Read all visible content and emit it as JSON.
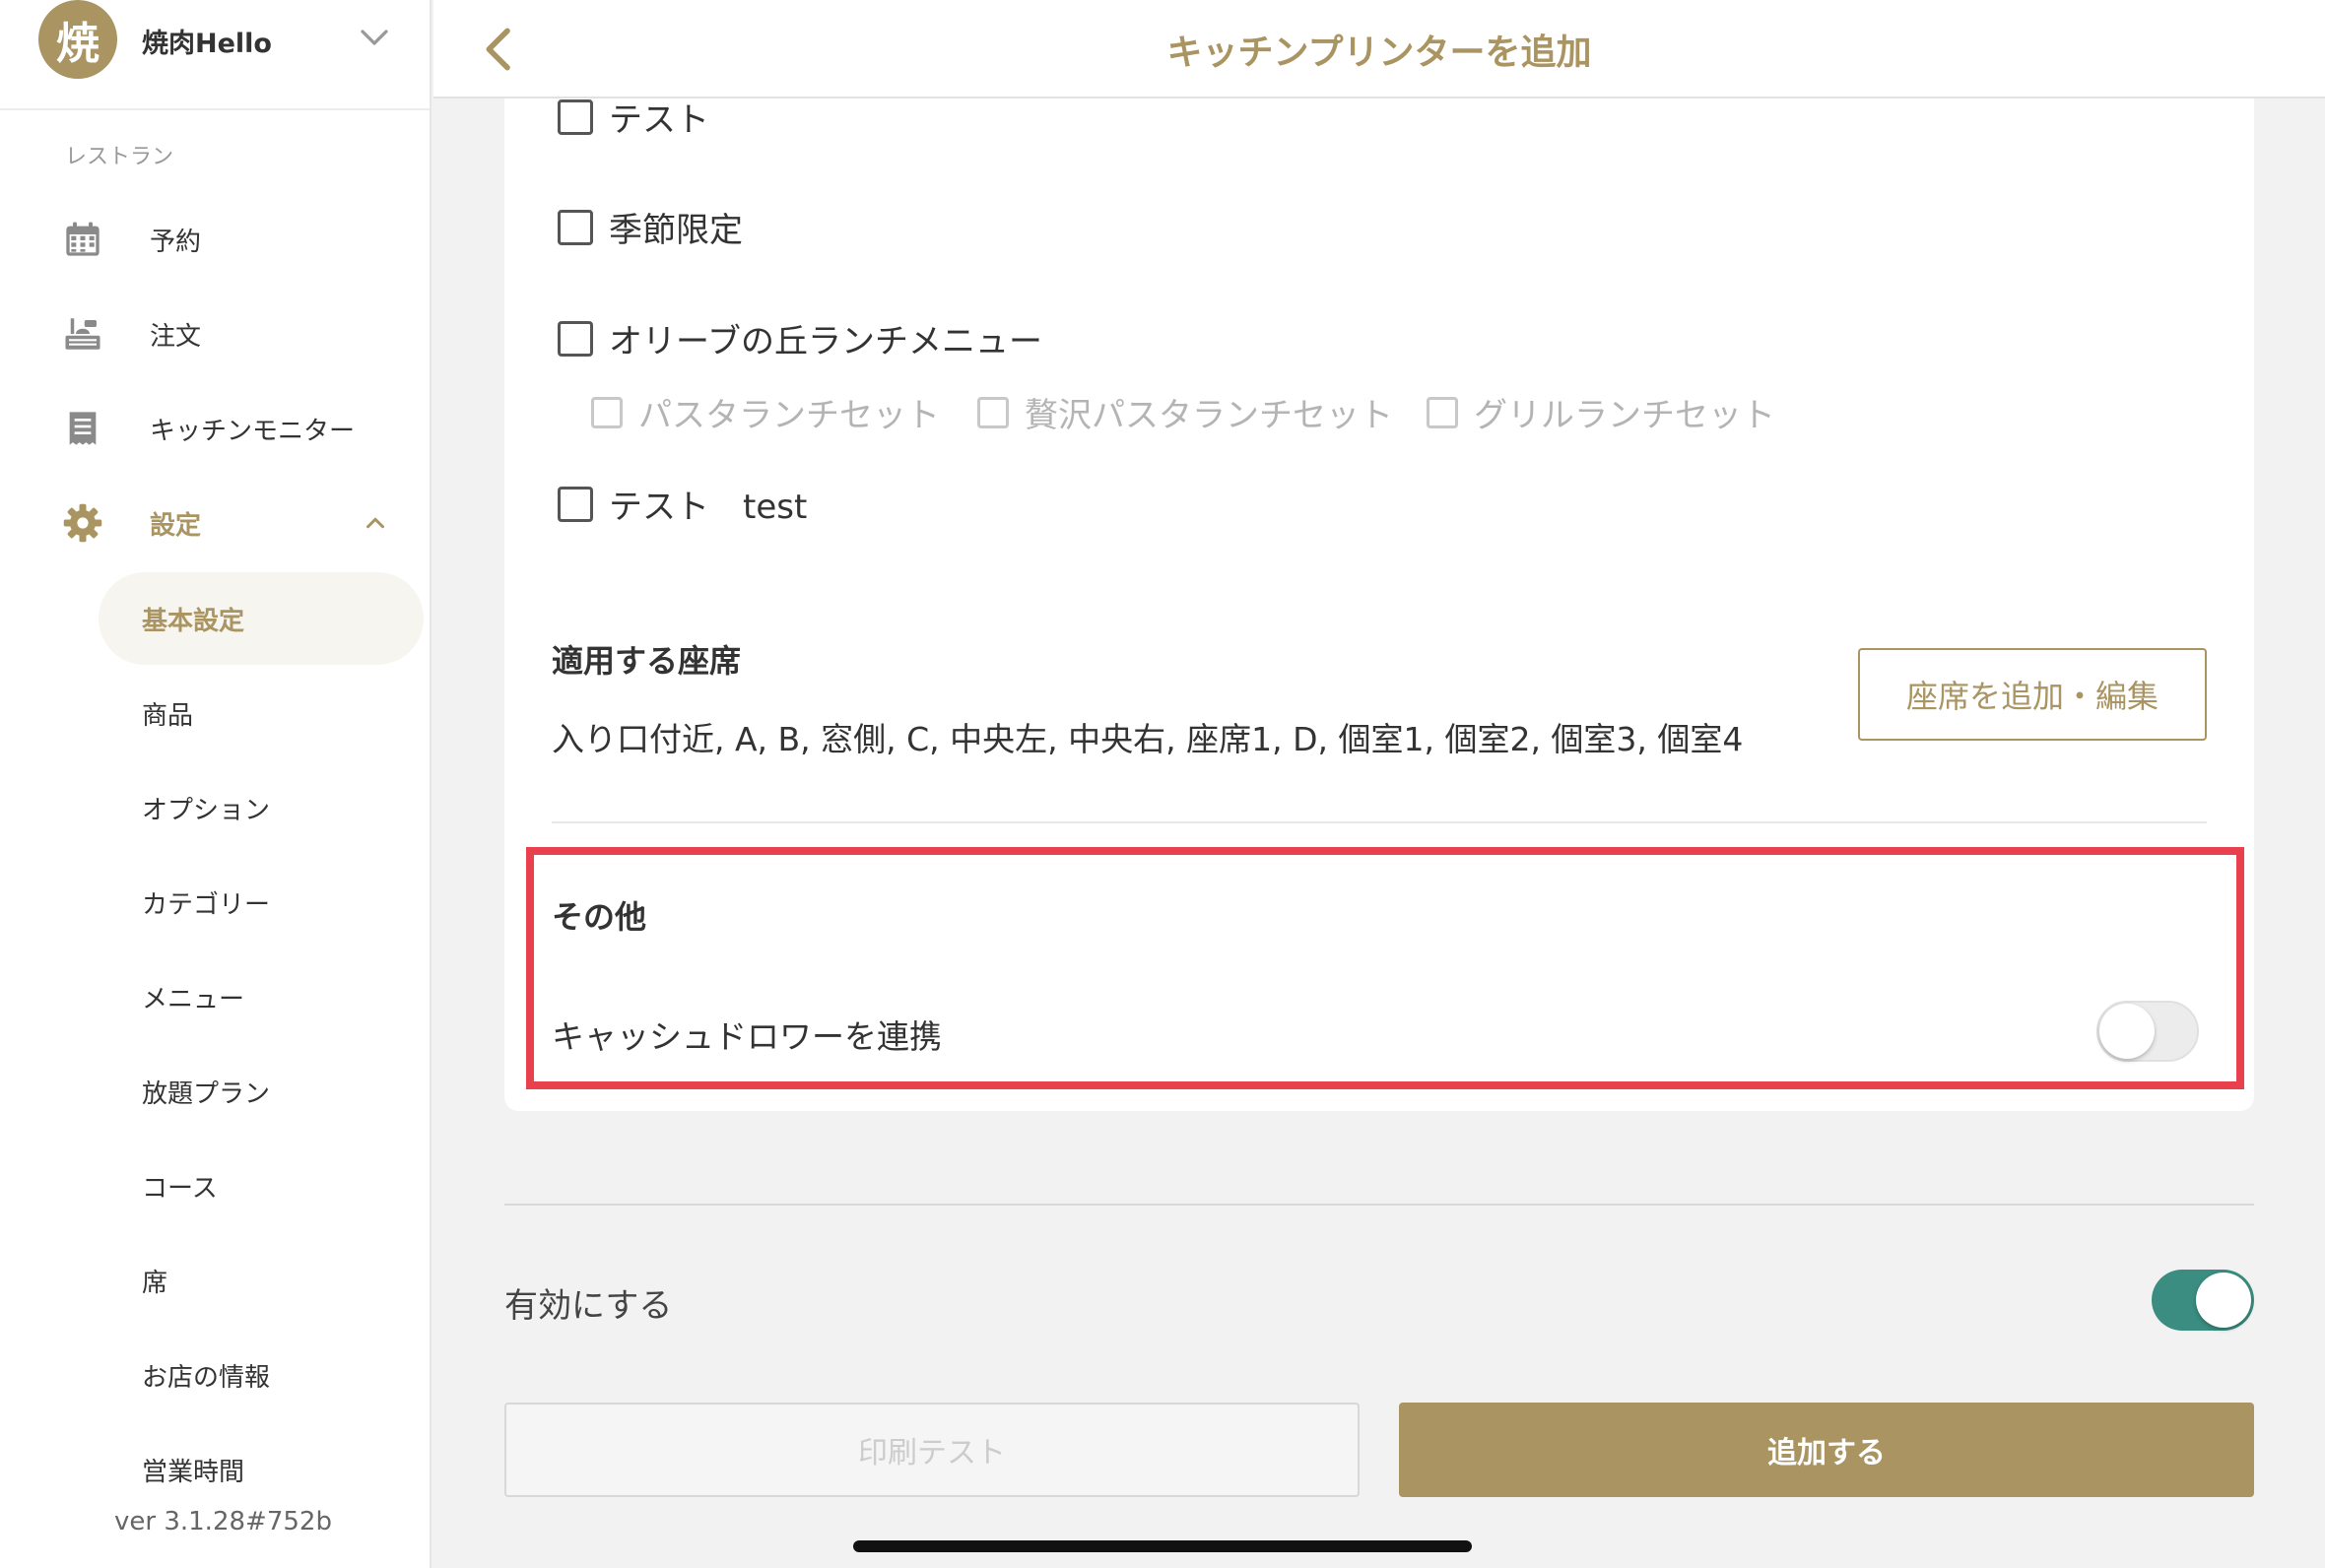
{
  "store": {
    "avatar_char": "焼",
    "name": "焼肉Hello"
  },
  "sidebar": {
    "section_label": "レストラン",
    "items": [
      {
        "label": "予約",
        "icon": "calendar-icon"
      },
      {
        "label": "注文",
        "icon": "order-tray-icon"
      },
      {
        "label": "キッチンモニター",
        "icon": "receipt-icon"
      },
      {
        "label": "設定",
        "icon": "gear-icon",
        "active": true
      }
    ],
    "sub_items": [
      {
        "label": "基本設定",
        "selected": true
      },
      {
        "label": "商品"
      },
      {
        "label": "オプション"
      },
      {
        "label": "カテゴリー"
      },
      {
        "label": "メニュー"
      },
      {
        "label": "放題プラン"
      },
      {
        "label": "コース"
      },
      {
        "label": "席"
      },
      {
        "label": "お店の情報"
      },
      {
        "label": "営業時間"
      }
    ],
    "version": "ver 3.1.28#752b"
  },
  "topbar": {
    "title": "キッチンプリンターを追加"
  },
  "categories": {
    "items": [
      {
        "label": "テスト"
      },
      {
        "label": "季節限定"
      },
      {
        "label": "オリーブの丘ランチメニュー"
      },
      {
        "label": "テスト　test"
      }
    ],
    "sub_items": [
      {
        "label": "パスタランチセット"
      },
      {
        "label": "贅沢パスタランチセット"
      },
      {
        "label": "グリルランチセット"
      }
    ]
  },
  "seats": {
    "title": "適用する座席",
    "list": "入り口付近, A, B, 窓側, C, 中央左, 中央右, 座席1, D, 個室1, 個室2, 個室3, 個室4",
    "edit_button": "座席を追加・編集"
  },
  "other": {
    "title": "その他",
    "cash_drawer_label": "キャッシュドロワーを連携",
    "cash_drawer_enabled": false
  },
  "enable": {
    "label": "有効にする",
    "enabled": true
  },
  "buttons": {
    "print_test": "印刷テスト",
    "add": "追加する"
  },
  "colors": {
    "accent": "#a99462",
    "toggle_on": "#3a8d80",
    "highlight": "#e8404d"
  }
}
